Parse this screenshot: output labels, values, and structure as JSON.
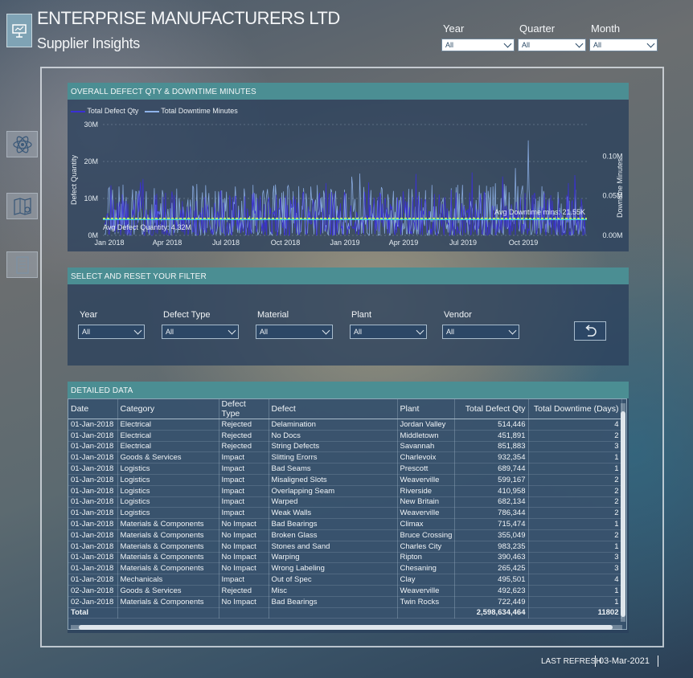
{
  "header": {
    "company": "ENTERPRISE MANUFACTURERS LTD",
    "subtitle": "Supplier Insights"
  },
  "top_slicers": [
    {
      "label": "Year",
      "value": "All"
    },
    {
      "label": "Quarter",
      "value": "All"
    },
    {
      "label": "Month",
      "value": "All"
    }
  ],
  "chart_panel": {
    "title": "OVERALL DEFECT QTY & DOWNTIME MINUTES"
  },
  "chart_data": {
    "type": "line",
    "legend": [
      "Total Defect Qty",
      "Total Downtime Minutes"
    ],
    "ylabel": "Defect Quantity",
    "y2label": "Downtime Minutes",
    "y_ticks": [
      "30M",
      "20M",
      "10M",
      "0M"
    ],
    "y2_ticks": [
      "0.10M",
      "0.05M",
      "0.00M"
    ],
    "x_ticks": [
      "Jan 2018",
      "Apr 2018",
      "Jul 2018",
      "Oct 2018",
      "Jan 2019",
      "Apr 2019",
      "Jul 2019",
      "Oct 2019"
    ],
    "ylim": [
      0,
      30000000
    ],
    "y2lim": [
      0,
      0.14
    ],
    "avg_defect_label": "Avg Defect Quantity: 4.32M",
    "avg_defect_value": 4320000,
    "avg_downtime_label": "Avg Downtime mins: 21.55K",
    "avg_downtime_value": 0.02155,
    "colors": {
      "defect": "#3a2fd6",
      "downtime": "#8fb3ea",
      "avg_defect": "#3fd0e8",
      "avg_downtime": "#d4ef4a"
    },
    "series": [
      {
        "name": "Total Defect Qty",
        "description": "daily totals, Jan 2018 – Dec 2019, mostly 0–12M with spikes up to ~18M"
      },
      {
        "name": "Total Downtime Minutes",
        "description": "daily totals, mostly 0–0.07M with one peak near 0.12M in Nov 2019"
      }
    ]
  },
  "filter_panel": {
    "title": "SELECT AND RESET YOUR FILTER",
    "slicers": [
      {
        "label": "Year",
        "value": "All"
      },
      {
        "label": "Defect Type",
        "value": "All"
      },
      {
        "label": "Material",
        "value": "All"
      },
      {
        "label": "Plant",
        "value": "All"
      },
      {
        "label": "Vendor",
        "value": "All"
      }
    ]
  },
  "table_panel": {
    "title": "DETAILED DATA",
    "columns": [
      "Date",
      "Category",
      "Defect Type",
      "Defect",
      "Plant",
      "Total Defect Qty",
      "Total Downtime (Days)"
    ],
    "rows": [
      [
        "01-Jan-2018",
        "Electrical",
        "Rejected",
        "Delamination",
        "Jordan Valley",
        "514,446",
        "4"
      ],
      [
        "01-Jan-2018",
        "Electrical",
        "Rejected",
        "No Docs",
        "Middletown",
        "451,891",
        "2"
      ],
      [
        "01-Jan-2018",
        "Electrical",
        "Rejected",
        "String Defects",
        "Savannah",
        "851,883",
        "3"
      ],
      [
        "01-Jan-2018",
        "Goods & Services",
        "Impact",
        "Slitting Erorrs",
        "Charlevoix",
        "932,354",
        "1"
      ],
      [
        "01-Jan-2018",
        "Logistics",
        "Impact",
        "Bad Seams",
        "Prescott",
        "689,744",
        "1"
      ],
      [
        "01-Jan-2018",
        "Logistics",
        "Impact",
        "Misaligned Slots",
        "Weaverville",
        "599,167",
        "2"
      ],
      [
        "01-Jan-2018",
        "Logistics",
        "Impact",
        "Overlapping Seam",
        "Riverside",
        "410,958",
        "2"
      ],
      [
        "01-Jan-2018",
        "Logistics",
        "Impact",
        "Warped",
        "New Britain",
        "682,134",
        "2"
      ],
      [
        "01-Jan-2018",
        "Logistics",
        "Impact",
        "Weak Walls",
        "Weaverville",
        "786,344",
        "2"
      ],
      [
        "01-Jan-2018",
        "Materials & Components",
        "No Impact",
        "Bad Bearings",
        "Climax",
        "715,474",
        "1"
      ],
      [
        "01-Jan-2018",
        "Materials & Components",
        "No Impact",
        "Broken Glass",
        "Bruce Crossing",
        "355,049",
        "2"
      ],
      [
        "01-Jan-2018",
        "Materials & Components",
        "No Impact",
        "Stones and Sand",
        "Charles City",
        "983,235",
        "1"
      ],
      [
        "01-Jan-2018",
        "Materials & Components",
        "No Impact",
        "Warping",
        "Ripton",
        "390,463",
        "3"
      ],
      [
        "01-Jan-2018",
        "Materials & Components",
        "No Impact",
        "Wrong Labeling",
        "Chesaning",
        "265,425",
        "3"
      ],
      [
        "01-Jan-2018",
        "Mechanicals",
        "Impact",
        "Out of Spec",
        "Clay",
        "495,501",
        "4"
      ],
      [
        "02-Jan-2018",
        "Goods & Services",
        "Rejected",
        "Misc",
        "Weaverville",
        "492,623",
        "1"
      ],
      [
        "02-Jan-2018",
        "Materials & Components",
        "No Impact",
        "Bad Bearings",
        "Twin Rocks",
        "722,449",
        "1"
      ]
    ],
    "total": {
      "label": "Total",
      "defect_qty": "2,598,634,464",
      "downtime": "11802"
    }
  },
  "footer": {
    "refresh_label": "LAST REFRESH",
    "refresh_date": "03-Mar-2021"
  }
}
